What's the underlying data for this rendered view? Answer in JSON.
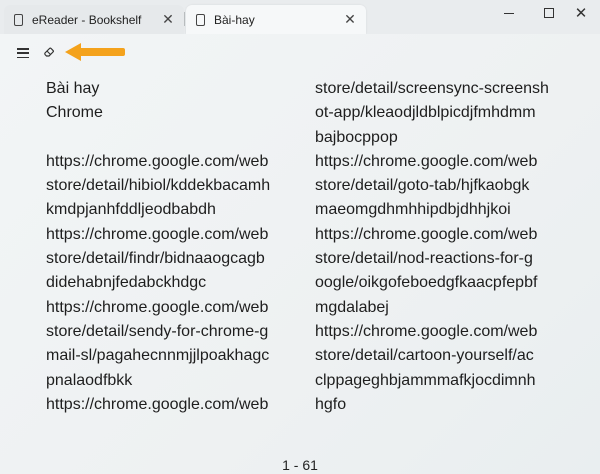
{
  "tabs": [
    {
      "label": "eReader - Bookshelf",
      "close": "✕"
    },
    {
      "label": "Bài-hay",
      "close": "✕"
    }
  ],
  "window": {
    "minimize": "",
    "maximize": "",
    "close": "✕"
  },
  "book": {
    "left_lines": [
      "Bài hay",
      "Chrome",
      "",
      "https://chrome.google.com/web",
      "store/detail/hibiol/kddekbacamh",
      "kmdpjanhfddljeodbabdh",
      "https://chrome.google.com/web",
      "store/detail/findr/bidnaaogcagb",
      "didehabnjfedabckhdgc",
      "https://chrome.google.com/web",
      "store/detail/sendy-for-chrome-g",
      "mail-sl/pagahecnnmjjlpoakhagc",
      "pnalaodfbkk",
      "https://chrome.google.com/web"
    ],
    "right_lines": [
      "store/detail/screensync-screensh",
      "ot-app/kleaodjldblpicdjfmhdmm",
      "bajbocppop",
      "https://chrome.google.com/web",
      "store/detail/goto-tab/hjfkaobgk",
      "maeomgdhmhhipdbjdhhjkoi",
      "https://chrome.google.com/web",
      "store/detail/nod-reactions-for-g",
      "oogle/oikgofeboedgfkaacpfepbf",
      "mgdalabej",
      "https://chrome.google.com/web",
      "store/detail/cartoon-yourself/ac",
      "clppageghbjammmafkjocdimnh",
      "hgfo"
    ]
  },
  "page_indicator": "1 - 61",
  "icons": {
    "menu": "hamburger-menu-icon",
    "eraser": "eraser-icon",
    "arrow": "orange-arrow-annotation"
  },
  "colors": {
    "arrow": "#f4a21c",
    "text": "#1e1e1e"
  }
}
